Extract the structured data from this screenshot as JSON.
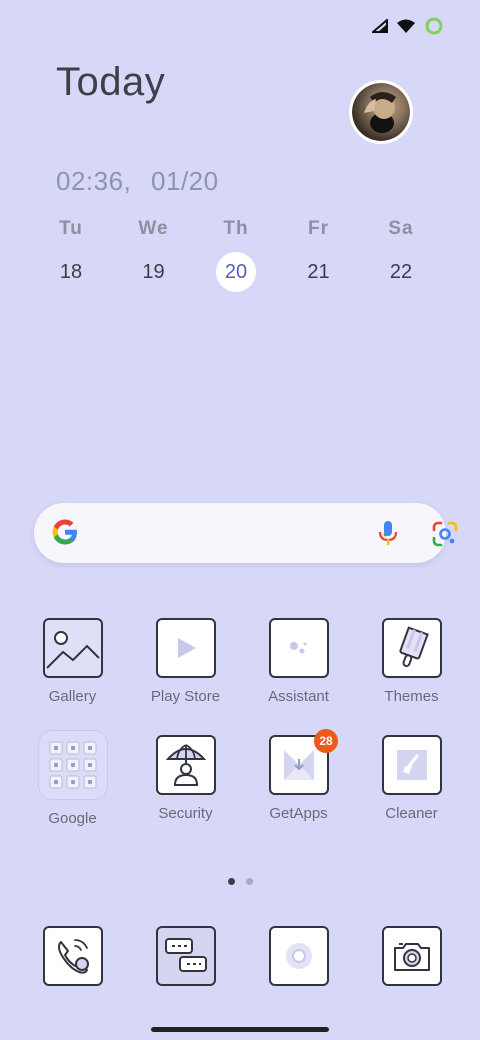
{
  "header": {
    "title": "Today",
    "time": "02:36,",
    "date": "01/20"
  },
  "calendar": {
    "days": [
      {
        "name": "Tu",
        "num": "18",
        "active": false
      },
      {
        "name": "We",
        "num": "19",
        "active": false
      },
      {
        "name": "Th",
        "num": "20",
        "active": true
      },
      {
        "name": "Fr",
        "num": "21",
        "active": false
      },
      {
        "name": "Sa",
        "num": "22",
        "active": false
      }
    ]
  },
  "search": {
    "icons": [
      "google-logo-icon",
      "microphone-icon",
      "google-lens-icon"
    ]
  },
  "apps": [
    {
      "label": "Gallery",
      "icon": "gallery-icon"
    },
    {
      "label": "Play Store",
      "icon": "play-store-icon"
    },
    {
      "label": "Assistant",
      "icon": "assistant-icon"
    },
    {
      "label": "Themes",
      "icon": "themes-icon"
    },
    {
      "label": "Google",
      "icon": "google-folder-icon"
    },
    {
      "label": "Security",
      "icon": "security-icon"
    },
    {
      "label": "GetApps",
      "icon": "getapps-icon",
      "badge": "28"
    },
    {
      "label": "Cleaner",
      "icon": "cleaner-icon"
    }
  ],
  "dock": [
    {
      "icon": "phone-icon"
    },
    {
      "icon": "messages-icon"
    },
    {
      "icon": "chrome-icon"
    },
    {
      "icon": "camera-icon"
    }
  ],
  "pager": {
    "pages": 2,
    "current": 1
  },
  "colors": {
    "background": "#d7d8f7",
    "badge": "#ef5a1b",
    "accent": "#5a5fb6",
    "battery_ring": "#7dd35e"
  }
}
